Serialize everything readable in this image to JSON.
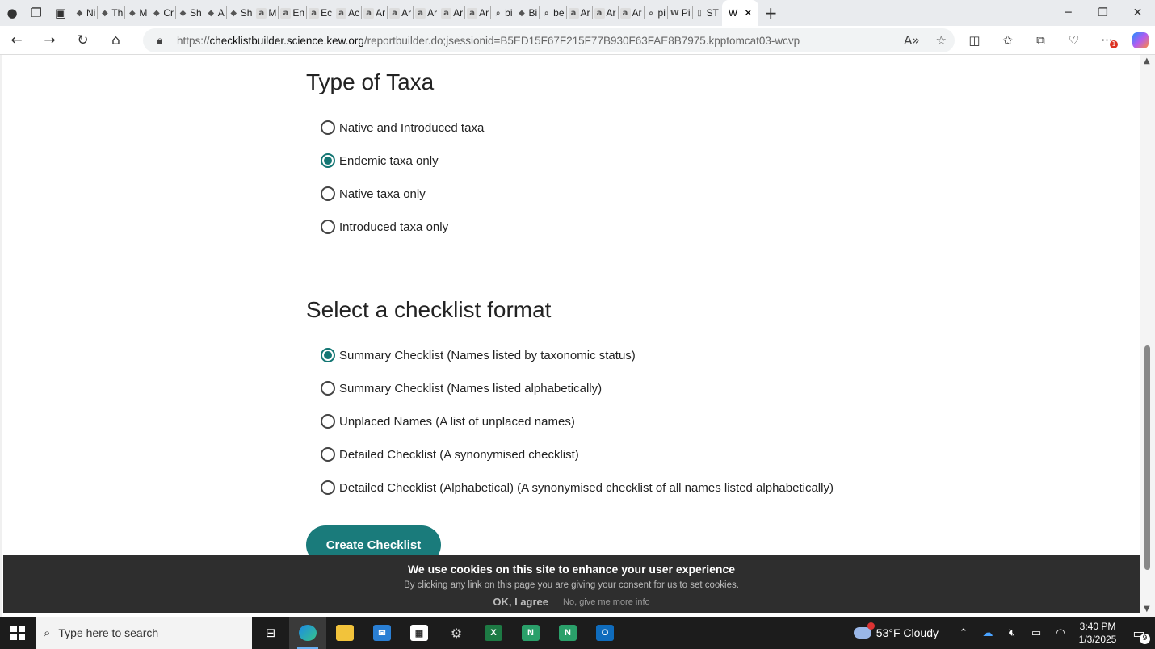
{
  "browser": {
    "tabs": [
      {
        "icon": "tab-favicon",
        "title": "Ni"
      },
      {
        "icon": "tab-favicon",
        "title": "Th"
      },
      {
        "icon": "tab-favicon",
        "title": "M"
      },
      {
        "icon": "tab-favicon",
        "title": "Cr"
      },
      {
        "icon": "tab-favicon",
        "title": "Sh"
      },
      {
        "icon": "tab-favicon",
        "title": "A"
      },
      {
        "icon": "tab-favicon",
        "title": "Sh"
      },
      {
        "icon": "amazon-icon",
        "title": "M"
      },
      {
        "icon": "amazon-icon",
        "title": "En"
      },
      {
        "icon": "amazon-icon",
        "title": "Ec"
      },
      {
        "icon": "amazon-icon",
        "title": "Ac"
      },
      {
        "icon": "amazon-icon",
        "title": "Ar"
      },
      {
        "icon": "amazon-icon",
        "title": "Ar"
      },
      {
        "icon": "amazon-icon",
        "title": "Ar"
      },
      {
        "icon": "amazon-icon",
        "title": "Ar"
      },
      {
        "icon": "amazon-icon",
        "title": "Ar"
      },
      {
        "icon": "search-icon",
        "title": "bi"
      },
      {
        "icon": "tab-favicon",
        "title": "Bi"
      },
      {
        "icon": "search-icon",
        "title": "be"
      },
      {
        "icon": "amazon-icon",
        "title": "Ar"
      },
      {
        "icon": "amazon-icon",
        "title": "Ar"
      },
      {
        "icon": "amazon-icon",
        "title": "Ar"
      },
      {
        "icon": "search-icon",
        "title": "pi"
      },
      {
        "icon": "wikipedia-icon",
        "title": "Pi"
      },
      {
        "icon": "document-icon",
        "title": "ST"
      }
    ],
    "active_tab_title": "W",
    "url_scheme": "https://",
    "url_host": "checklistbuilder.science.kew.org",
    "url_path": "/reportbuilder.do;jsessionid=B5ED15F67F215F77B930F63FAE8B7975.kpptomcat03-wcvp",
    "notification_count": "1"
  },
  "page": {
    "taxa_heading": "Type of Taxa",
    "taxa_options": [
      {
        "label": "Native and Introduced taxa",
        "checked": false
      },
      {
        "label": "Endemic taxa only",
        "checked": true
      },
      {
        "label": "Native taxa only",
        "checked": false
      },
      {
        "label": "Introduced taxa only",
        "checked": false
      }
    ],
    "format_heading": "Select a checklist format",
    "format_options": [
      {
        "label": "Summary Checklist (Names listed by taxonomic status)",
        "checked": true
      },
      {
        "label": "Summary Checklist (Names listed alphabetically)",
        "checked": false
      },
      {
        "label": "Unplaced Names (A list of unplaced names)",
        "checked": false
      },
      {
        "label": "Detailed Checklist (A synonymised checklist)",
        "checked": false
      },
      {
        "label": "Detailed Checklist (Alphabetical) (A synonymised checklist of all names listed alphabetically)",
        "checked": false
      }
    ],
    "create_button": "Create Checklist",
    "accent_color": "#1a7b7b"
  },
  "cookie_banner": {
    "title": "We use cookies on this site to enhance your user experience",
    "subtitle": "By clicking any link on this page you are giving your consent for us to set cookies.",
    "agree": "OK, I agree",
    "more_info": "No, give me more info"
  },
  "taskbar": {
    "search_placeholder": "Type here to search",
    "weather": "53°F  Cloudy",
    "time": "3:40 PM",
    "date": "1/3/2025",
    "notifications": "9"
  }
}
